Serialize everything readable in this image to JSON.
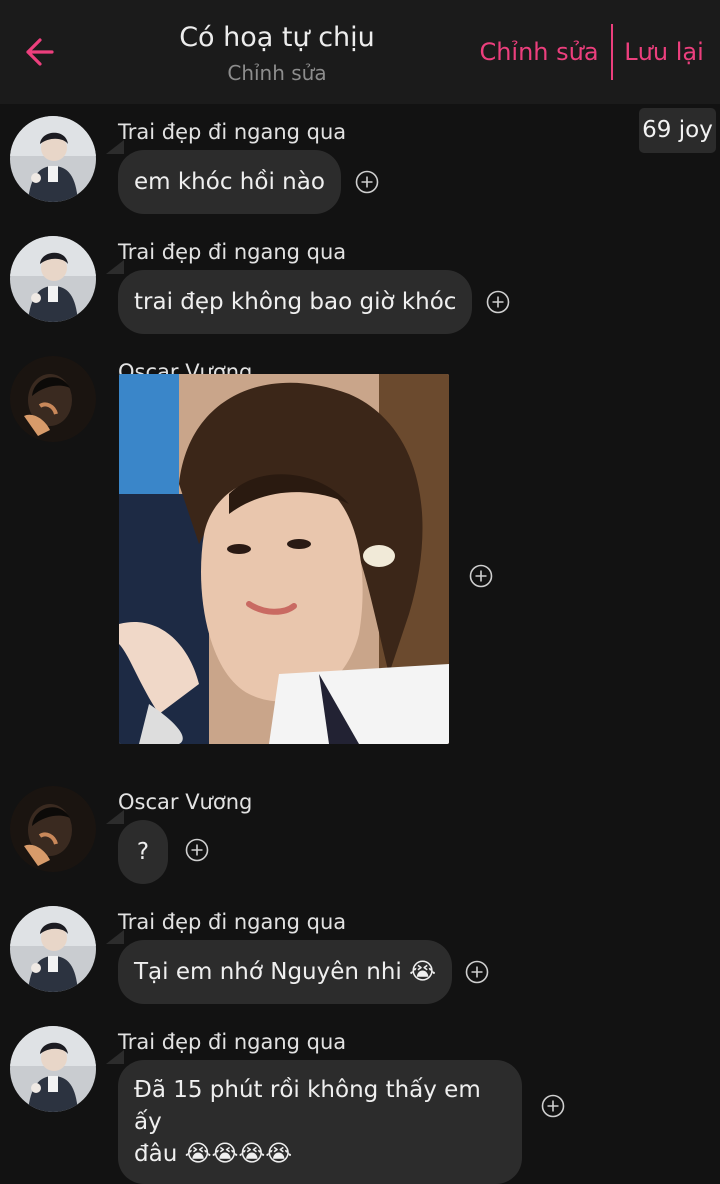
{
  "header": {
    "title": "Có hoạ tự chịu",
    "subtitle": "Chỉnh sửa",
    "edit_label": "Chỉnh sửa",
    "save_label": "Lưu lại"
  },
  "joy_badge": "69 joy",
  "colors": {
    "accent": "#ec3f7d",
    "background": "#121212",
    "bubble": "#2c2c2c"
  },
  "messages": [
    {
      "sender": "Trai đẹp đi ngang qua",
      "text": "em khóc hồi nào",
      "avatar": "avatar-boy-suit"
    },
    {
      "sender": "Trai đẹp đi ngang qua",
      "text": "trai đẹp không bao giờ khóc",
      "avatar": "avatar-boy-suit"
    },
    {
      "sender": "Oscar Vương",
      "image": "photo-portrait",
      "avatar": "avatar-dark-portrait"
    },
    {
      "sender": "Oscar Vương",
      "text": "?",
      "avatar": "avatar-dark-portrait"
    },
    {
      "sender": "Trai đẹp đi ngang qua",
      "text": "Tại em nhớ Nguyên nhi 😭",
      "avatar": "avatar-boy-suit"
    },
    {
      "sender": "Trai đẹp đi ngang qua",
      "text_line1": "Đã 15 phút rồi không thấy em ấy",
      "text_line2": "đâu 😭😭😭😭",
      "avatar": "avatar-boy-suit"
    }
  ],
  "icons": {
    "back": "back-arrow-icon",
    "add_reaction": "plus-circle-icon"
  }
}
